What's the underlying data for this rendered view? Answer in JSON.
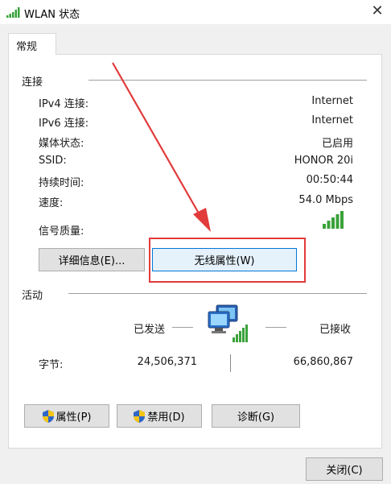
{
  "window": {
    "title": "WLAN 状态",
    "close_glyph": "✕"
  },
  "tabs": [
    {
      "label": "常规"
    }
  ],
  "connection": {
    "section_title": "连接",
    "rows": [
      {
        "label": "IPv4 连接:",
        "value": "Internet"
      },
      {
        "label": "IPv6 连接:",
        "value": "Internet"
      },
      {
        "label": "媒体状态:",
        "value": "已启用"
      },
      {
        "label": "SSID:",
        "value": "HONOR 20i"
      },
      {
        "label": "持续时间:",
        "value": "00:50:44"
      },
      {
        "label": "速度:",
        "value": "54.0 Mbps"
      }
    ],
    "signal_label": "信号质量:",
    "signal_bars": 5
  },
  "buttons": {
    "details": "详细信息(E)...",
    "wireless_properties": "无线属性(W)",
    "properties": "属性(P)",
    "disable": "禁用(D)",
    "diagnose": "诊断(G)",
    "close": "关闭(C)"
  },
  "activity": {
    "section_title": "活动",
    "sent_label": "已发送",
    "received_label": "已接收",
    "bytes_label": "字节:",
    "bytes_sent": "24,506,371",
    "bytes_received": "66,860,867"
  },
  "colors": {
    "signal_green": "#3aa23a",
    "highlight_red": "#e23b3b",
    "accent_blue": "#0078d7"
  },
  "icons": [
    "wifi-signal-icon",
    "network-computers-icon",
    "uac-shield-icon",
    "close-icon",
    "red-arrow-annotation"
  ]
}
